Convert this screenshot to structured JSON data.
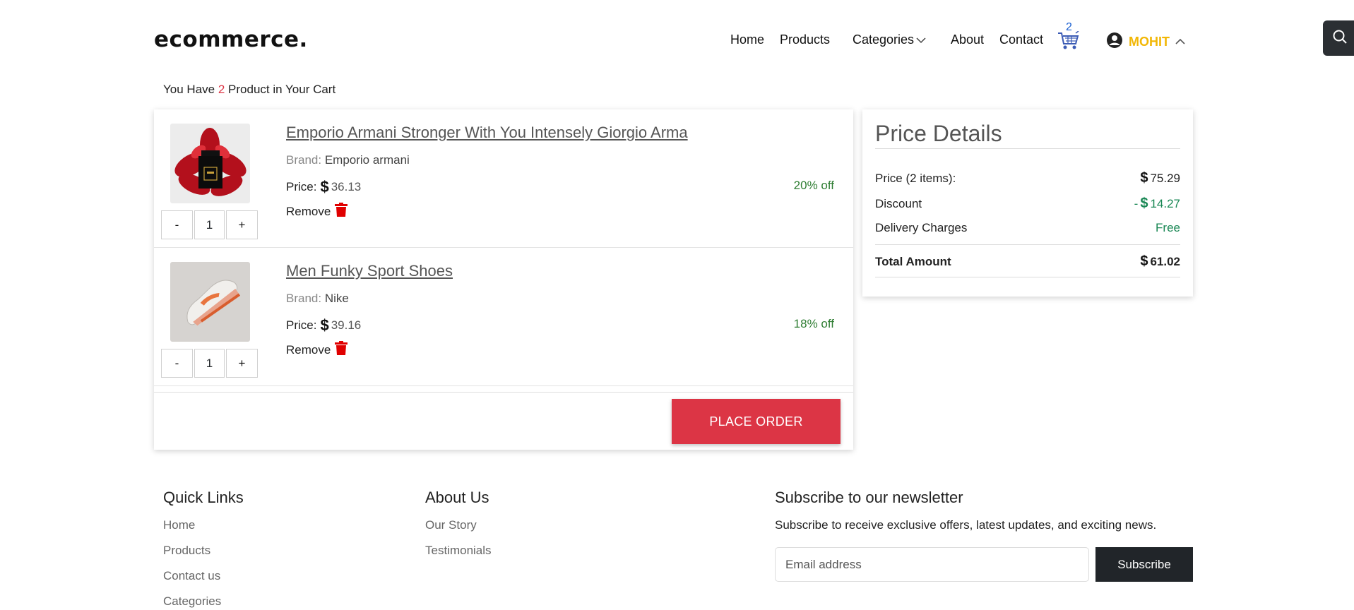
{
  "header": {
    "logo": "ecommerce.",
    "nav": {
      "home": "Home",
      "products": "Products",
      "categories": "Categories",
      "about": "About",
      "contact": "Contact"
    },
    "cart_count": "2",
    "user_name": "MOHIT",
    "accent_color": "#f2b705"
  },
  "cart_summary": {
    "prefix": "You Have",
    "count": "2",
    "suffix": "Product in Your Cart"
  },
  "cart": {
    "items": [
      {
        "title": "Emporio Armani Stronger With You Intensely Giorgio Arma",
        "brand_label": "Brand:",
        "brand": "Emporio armani",
        "price_label": "Price:",
        "price": "36.13",
        "discount": "20% off",
        "remove_label": "Remove",
        "quantity": "1",
        "minus": "-",
        "plus": "+"
      },
      {
        "title": "Men Funky Sport Shoes",
        "brand_label": "Brand:",
        "brand": "Nike",
        "price_label": "Price:",
        "price": "39.16",
        "discount": "18% off",
        "remove_label": "Remove",
        "quantity": "1",
        "minus": "-",
        "plus": "+"
      }
    ],
    "place_order": "PLACE ORDER"
  },
  "price_details": {
    "title": "Price Details",
    "price_label": "Price (2 items):",
    "price_value": "75.29",
    "discount_label": "Discount",
    "discount_prefix": "-",
    "discount_value": "14.27",
    "delivery_label": "Delivery Charges",
    "delivery_value": "Free",
    "total_label": "Total Amount",
    "total_value": "61.02"
  },
  "footer": {
    "quick_links": {
      "title": "Quick Links",
      "links": [
        "Home",
        "Products",
        "Contact us",
        "Categories"
      ]
    },
    "about": {
      "title": "About Us",
      "links": [
        "Our Story",
        "Testimonials"
      ]
    },
    "newsletter": {
      "title": "Subscribe to our newsletter",
      "text": "Subscribe to receive exclusive offers, latest updates, and exciting news.",
      "placeholder": "Email address",
      "button": "Subscribe"
    }
  },
  "colors": {
    "danger": "#dc3545",
    "success": "#198754",
    "dark": "#212529"
  }
}
